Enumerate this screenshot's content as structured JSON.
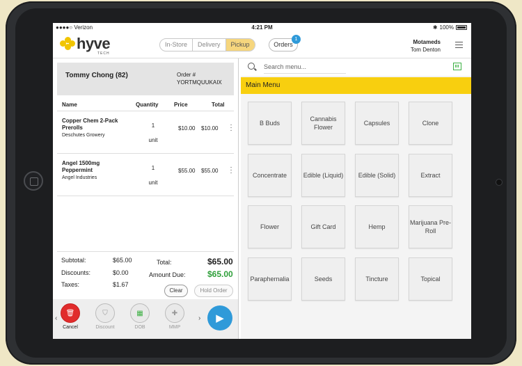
{
  "status": {
    "carrier": "●●●●○ Verizon",
    "time": "4:21 PM",
    "battery": "100%"
  },
  "brand": {
    "name": "hyve",
    "sub": "TECH"
  },
  "modes": [
    {
      "label": "In-Store",
      "active": false
    },
    {
      "label": "Delivery",
      "active": false
    },
    {
      "label": "Pickup",
      "active": true
    }
  ],
  "orders": {
    "label": "Orders",
    "badge": "1"
  },
  "account": {
    "store": "Motameds",
    "user": "Tom Denton"
  },
  "customer": {
    "name": "Tommy Chong (82)",
    "order_label": "Order #",
    "order_number": "YORTMQUUKAIX"
  },
  "table": {
    "headers": {
      "name": "Name",
      "quantity": "Quantity",
      "price": "Price",
      "total": "Total"
    },
    "rows": [
      {
        "name": "Copper Chem 2-Pack Prerolls",
        "vendor": "Deschutes Growery",
        "qty": "1",
        "unit": "unit",
        "price": "$10.00",
        "total": "$10.00"
      },
      {
        "name": "Angel 1500mg Peppermint",
        "vendor": "Angel Industries",
        "qty": "1",
        "unit": "unit",
        "price": "$55.00",
        "total": "$55.00"
      }
    ]
  },
  "summary": {
    "subtotal_label": "Subtotal:",
    "subtotal": "$65.00",
    "discounts_label": "Discounts:",
    "discounts": "$0.00",
    "taxes_label": "Taxes:",
    "taxes": "$1.67",
    "total_label": "Total:",
    "total": "$65.00",
    "due_label": "Amount Due:",
    "due": "$65.00",
    "clear": "Clear",
    "hold": "Hold Order"
  },
  "actions": [
    {
      "label": "Cancel",
      "icon": "trash-icon"
    },
    {
      "label": "Discount",
      "icon": "tag-icon"
    },
    {
      "label": "DOB",
      "icon": "calendar-icon"
    },
    {
      "label": "MMP",
      "icon": "medical-bag-icon"
    }
  ],
  "search": {
    "placeholder": "Search menu..."
  },
  "menu": {
    "title": "Main Menu",
    "categories": [
      "B Buds",
      "Cannabis Flower",
      "Capsules",
      "Clone",
      "Concentrate",
      "Edible (Liquid)",
      "Edible (Solid)",
      "Extract",
      "Flower",
      "Gift Card",
      "Hemp",
      "Marijuana Pre-Roll",
      "Paraphernalia",
      "Seeds",
      "Tincture",
      "Topical"
    ]
  },
  "colors": {
    "accent": "#f8cf0f",
    "primary": "#2f9ad9",
    "danger": "#e12c2c",
    "amount_due": "#2f9f3a"
  }
}
